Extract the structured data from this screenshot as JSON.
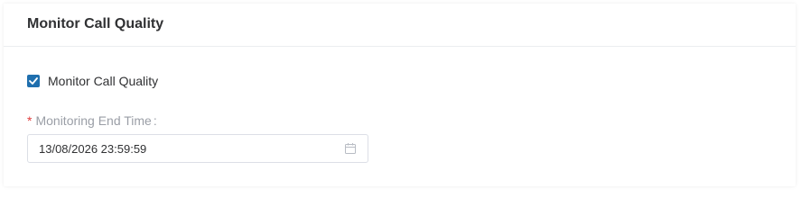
{
  "card": {
    "title": "Monitor Call Quality"
  },
  "monitor_checkbox": {
    "label": "Monitor Call Quality",
    "checked": true
  },
  "end_time_field": {
    "required_marker": "*",
    "label": "Monitoring End Time",
    "label_suffix": ":",
    "value": "13/08/2026 23:59:59"
  },
  "colors": {
    "checkbox_checked": "#1f6fae",
    "required": "#e03b3b"
  }
}
